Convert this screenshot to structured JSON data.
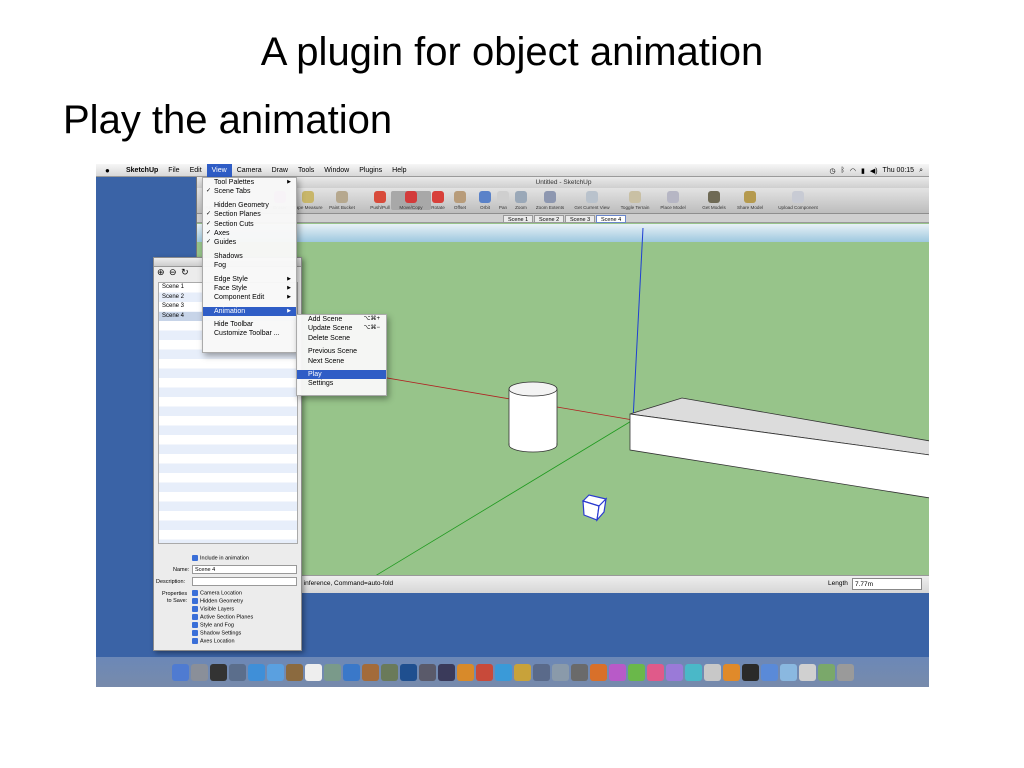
{
  "slide": {
    "title": "A plugin for object animation",
    "subtitle": "Play the animation"
  },
  "menubar": {
    "app": "SketchUp",
    "items": [
      "File",
      "Edit",
      "View",
      "Camera",
      "Draw",
      "Tools",
      "Window",
      "Plugins",
      "Help"
    ],
    "clock": "Thu 00:15"
  },
  "window": {
    "title": "Untitled - SketchUp",
    "tools": [
      "Arc",
      "Component Maker",
      "Eraser",
      "Tape Measure",
      "Paint Bucket",
      "Push/Pull",
      "Move/Copy",
      "Rotate",
      "Offset",
      "Orbit",
      "Pan",
      "Zoom",
      "Zoom Extents",
      "Get Current View",
      "Toggle Terrain",
      "Place Model",
      "Get Models",
      "Share Model",
      "Upload Component"
    ],
    "scene_tabs": [
      "Scene 1",
      "Scene 2",
      "Scene 3",
      "Scene 4"
    ],
    "status_text": "to move.  Option=copy, Shift=lock inference, Command=auto-fold",
    "length_label": "Length",
    "length_value": "7.77m"
  },
  "view_menu": {
    "items": [
      "Tool Palettes",
      "Scene Tabs",
      "Hidden Geometry",
      "Section Planes",
      "Section Cuts",
      "Axes",
      "Guides",
      "Shadows",
      "Fog",
      "Edge Style",
      "Face Style",
      "Component Edit",
      "Animation",
      "Hide Toolbar",
      "Customize Toolbar ..."
    ]
  },
  "animation_menu": {
    "add_scene": "Add Scene",
    "add_scene_shortcut": "⌥⌘+",
    "update_scene": "Update Scene",
    "update_scene_shortcut": "⌥⌘−",
    "delete_scene": "Delete Scene",
    "previous_scene": "Previous Scene",
    "next_scene": "Next Scene",
    "play": "Play",
    "settings": "Settings"
  },
  "scenes_panel": {
    "controls": "⊕ ⊖ ↻",
    "scenes": [
      "Scene 1",
      "Scene 2",
      "Scene 3",
      "Scene 4"
    ],
    "include_label": "Include in animation",
    "name_label": "Name:",
    "name_value": "Scene 4",
    "description_label": "Description:",
    "properties_label_1": "Properties",
    "properties_label_2": "to Save:",
    "properties": [
      "Camera Location",
      "Hidden Geometry",
      "Visible Layers",
      "Active Section Planes",
      "Style and Fog",
      "Shadow Settings",
      "Axes Location"
    ]
  }
}
